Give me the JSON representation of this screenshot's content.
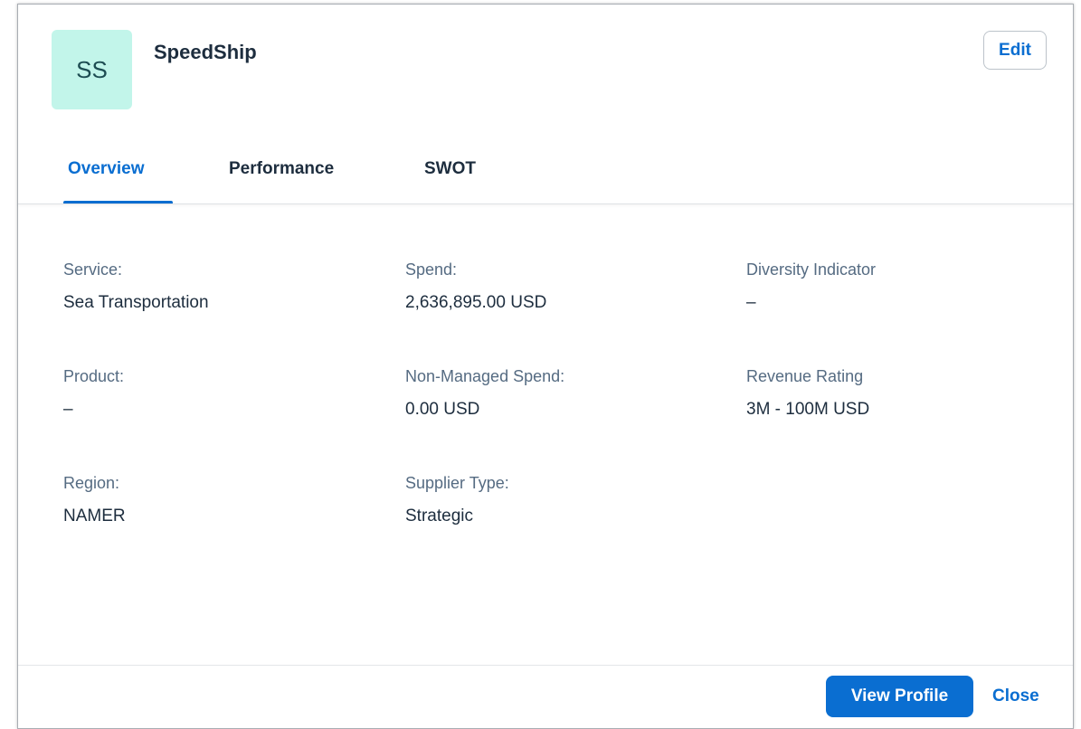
{
  "header": {
    "avatar_initials": "SS",
    "title": "SpeedShip",
    "edit_label": "Edit"
  },
  "tabs": [
    {
      "label": "Overview",
      "active": true
    },
    {
      "label": "Performance",
      "active": false
    },
    {
      "label": "SWOT",
      "active": false
    }
  ],
  "fields": {
    "service": {
      "label": "Service:",
      "value": "Sea Transportation"
    },
    "spend": {
      "label": "Spend:",
      "value": "2,636,895.00 USD"
    },
    "diversity": {
      "label": "Diversity Indicator",
      "value": "–"
    },
    "product": {
      "label": "Product:",
      "value": "–"
    },
    "non_managed_spend": {
      "label": "Non-Managed Spend:",
      "value": "0.00 USD"
    },
    "revenue_rating": {
      "label": "Revenue Rating",
      "value": "3M - 100M USD"
    },
    "region": {
      "label": "Region:",
      "value": "NAMER"
    },
    "supplier_type": {
      "label": "Supplier Type:",
      "value": "Strategic"
    }
  },
  "footer": {
    "view_profile_label": "View Profile",
    "close_label": "Close"
  },
  "colors": {
    "accent": "#0a6ed1",
    "avatar_bg": "#c2f5ea",
    "text": "#1d2d3e",
    "label": "#556b82"
  }
}
